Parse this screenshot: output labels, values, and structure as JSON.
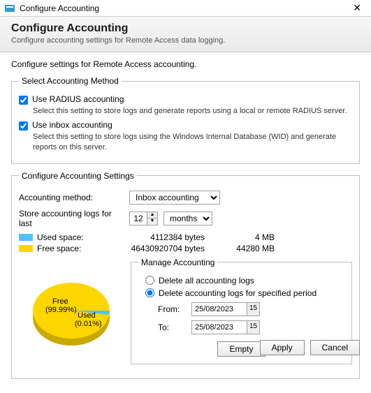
{
  "window": {
    "title": "Configure Accounting",
    "close": "✕"
  },
  "header": {
    "title": "Configure Accounting",
    "subtitle": "Configure accounting settings for Remote Access data logging."
  },
  "intro": "Configure settings for Remote Access accounting.",
  "method": {
    "legend": "Select Accounting Method",
    "radius": {
      "label": "Use RADIUS accounting",
      "desc": "Select this setting to store logs and generate reports using a local or remote RADIUS server."
    },
    "inbox": {
      "label": "Use inbox accounting",
      "desc": "Select this setting to store logs using the Windows Internal Database (WID) and generate reports on this server."
    }
  },
  "settings": {
    "legend": "Configure Accounting Settings",
    "method_label": "Accounting method:",
    "method_value": "Inbox accounting",
    "store_label": "Store accounting logs for last",
    "store_value": "12",
    "store_unit": "months",
    "used": {
      "label": "Used space:",
      "bytes": "4112384 bytes",
      "human": "4 MB"
    },
    "free": {
      "label": "Free space:",
      "bytes": "46430920704 bytes",
      "human": "44280 MB"
    },
    "manage": {
      "legend": "Manage Accounting",
      "opt_all": "Delete all accounting logs",
      "opt_period": "Delete accounting logs for specified period",
      "from_label": "From:",
      "from_value": "25/08/2023",
      "to_label": "To:",
      "to_value": "25/08/2023",
      "empty": "Empty"
    },
    "pie": {
      "free_label": "Free",
      "free_pct": "(99.99%)",
      "used_label": "Used",
      "used_pct": "(0.01%)"
    }
  },
  "chart_data": {
    "type": "pie",
    "series": [
      {
        "name": "Free",
        "value": 99.99,
        "color": "#ffd600"
      },
      {
        "name": "Used",
        "value": 0.01,
        "color": "#4fc3f7"
      }
    ],
    "title": ""
  },
  "footer": {
    "apply": "Apply",
    "cancel": "Cancel"
  },
  "colors": {
    "used": "#4fc3f7",
    "free": "#ffd600"
  }
}
